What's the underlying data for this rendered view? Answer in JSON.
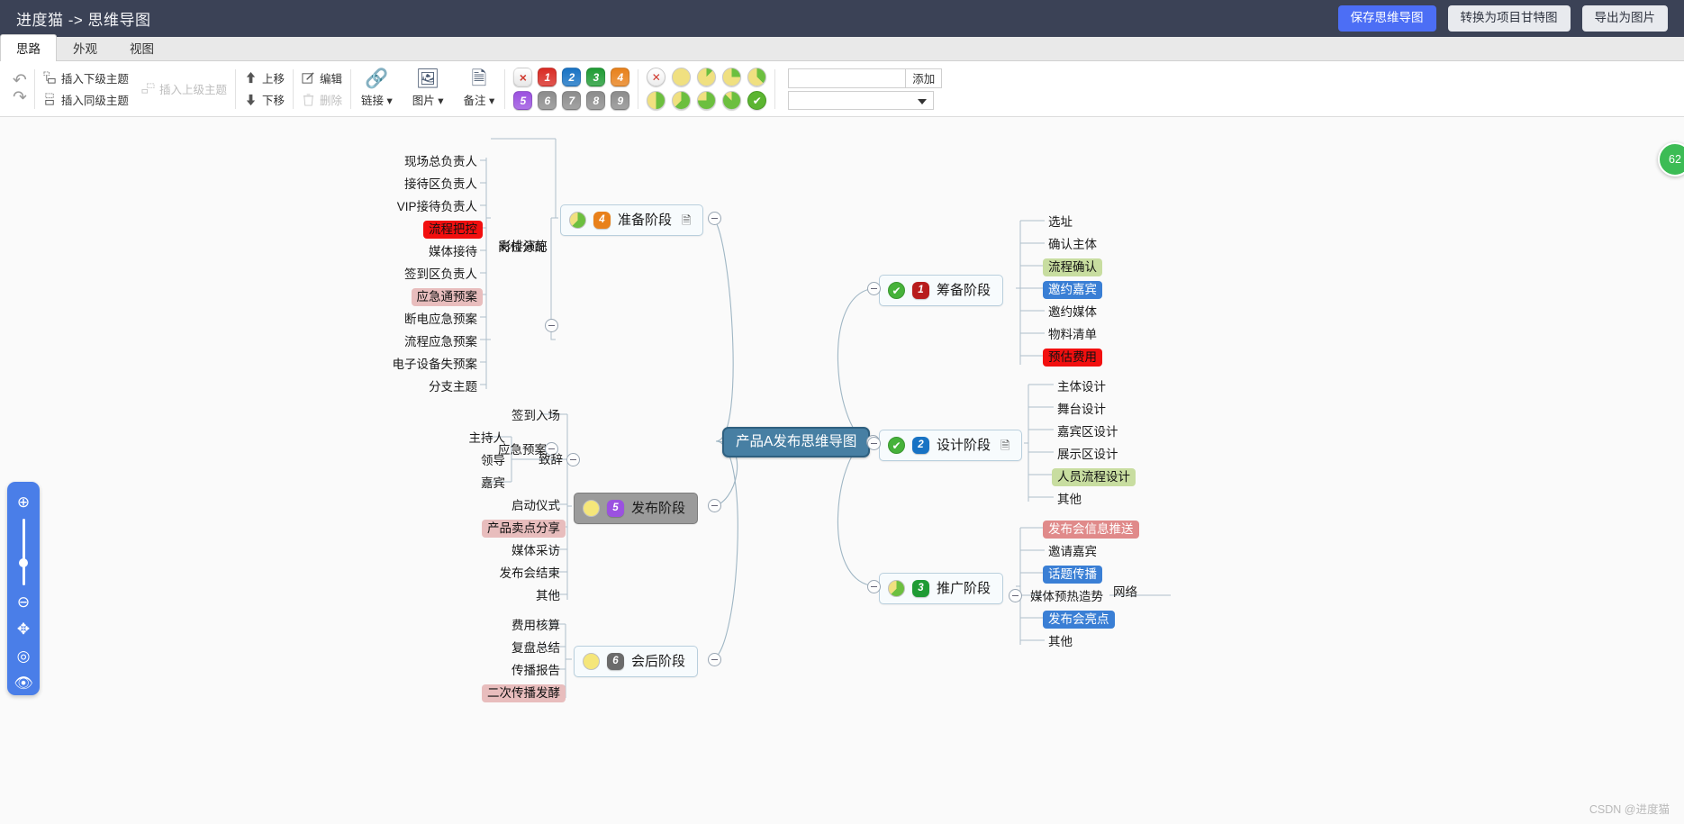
{
  "titlebar": {
    "app_title": "进度猫 -> 思维导图",
    "buttons": [
      {
        "label": "保存思维导图",
        "style": "primary"
      },
      {
        "label": "转换为项目甘特图",
        "style": "light"
      },
      {
        "label": "导出为图片",
        "style": "light"
      }
    ]
  },
  "tabs": [
    {
      "label": "思路",
      "active": true
    },
    {
      "label": "外观",
      "active": false
    },
    {
      "label": "视图",
      "active": false
    }
  ],
  "toolbar": {
    "undo_icon": "undo-icon",
    "redo_icon": "redo-icon",
    "insert_child": "插入下级主题",
    "insert_parent": "插入上级主题",
    "insert_sibling": "插入同级主题",
    "move_up": "上移",
    "move_down": "下移",
    "edit": "编辑",
    "delete": "删除",
    "link": "链接",
    "image": "图片",
    "note": "备注",
    "priority_chips": [
      "×",
      "1",
      "2",
      "3",
      "4",
      "5",
      "6",
      "7",
      "8",
      "9"
    ],
    "priority_colors": [
      "#ffffff",
      "#d92b24",
      "#1873c4",
      "#1f9b34",
      "#e8811b",
      "#9b51e0",
      "#8c8c8c",
      "#8c8c8c",
      "#8c8c8c",
      "#8c8c8c"
    ],
    "progress_labels": [
      "0%",
      "12%",
      "25%",
      "37%",
      "50%",
      "62%",
      "75%",
      "87%",
      "100%"
    ],
    "add_input_value": "",
    "add_button": "添加",
    "select_value": ""
  },
  "mindmap": {
    "root": "产品A发布思维导图",
    "phases": [
      {
        "name": "准备阶段",
        "priority": "4",
        "priority_color": "#e8811b",
        "progress": 62,
        "has_note": true,
        "selected": false
      },
      {
        "name": "筹备阶段",
        "priority": "1",
        "priority_color": "#b81d1d",
        "progress": 100,
        "has_note": false,
        "selected": false
      },
      {
        "name": "设计阶段",
        "priority": "2",
        "priority_color": "#1873c4",
        "progress": 100,
        "has_note": true,
        "selected": false
      },
      {
        "name": "发布阶段",
        "priority": "5",
        "priority_color": "#9b51e0",
        "progress": 0,
        "has_note": false,
        "selected": true
      },
      {
        "name": "推广阶段",
        "priority": "3",
        "priority_color": "#1f9b34",
        "progress": 62,
        "has_note": false,
        "selected": false
      },
      {
        "name": "会后阶段",
        "priority": "6",
        "priority_color": "#6b6b6b",
        "progress": 0,
        "has_note": false,
        "selected": false
      }
    ],
    "prep_rehearsal": "彩排演练",
    "prep_group_posts": "岗位分配",
    "prep_group_emergency": "应急预案",
    "posts_items": [
      {
        "label": "现场总负责人",
        "style": "plain"
      },
      {
        "label": "接待区负责人",
        "style": "plain"
      },
      {
        "label": "VIP接待负责人",
        "style": "plain"
      },
      {
        "label": "流程把控",
        "style": "red"
      },
      {
        "label": "媒体接待",
        "style": "plain"
      },
      {
        "label": "签到区负责人",
        "style": "plain"
      }
    ],
    "emergency_items": [
      {
        "label": "应急通预案",
        "style": "pink"
      },
      {
        "label": "断电应急预案",
        "style": "plain"
      },
      {
        "label": "流程应急预案",
        "style": "plain"
      },
      {
        "label": "电子设备失预案",
        "style": "plain"
      },
      {
        "label": "分支主题",
        "style": "plain"
      }
    ],
    "release_items": [
      {
        "label": "签到入场",
        "style": "plain"
      },
      {
        "label": "致辞",
        "style": "plain"
      },
      {
        "label": "启动仪式",
        "style": "plain"
      },
      {
        "label": "产品卖点分享",
        "style": "pink"
      },
      {
        "label": "媒体采访",
        "style": "plain"
      },
      {
        "label": "发布会结束",
        "style": "plain"
      },
      {
        "label": "其他",
        "style": "plain"
      }
    ],
    "speech_items": [
      {
        "label": "主持人",
        "style": "plain"
      },
      {
        "label": "领导",
        "style": "plain"
      },
      {
        "label": "嘉宾",
        "style": "plain"
      }
    ],
    "post_meeting_items": [
      {
        "label": "费用核算",
        "style": "plain"
      },
      {
        "label": "复盘总结",
        "style": "plain"
      },
      {
        "label": "传播报告",
        "style": "plain"
      },
      {
        "label": "二次传播发酵",
        "style": "pink"
      }
    ],
    "planning_items": [
      {
        "label": "选址",
        "style": "plain"
      },
      {
        "label": "确认主体",
        "style": "plain"
      },
      {
        "label": "流程确认",
        "style": "green"
      },
      {
        "label": "邀约嘉宾",
        "style": "blue"
      },
      {
        "label": "邀约媒体",
        "style": "plain"
      },
      {
        "label": "物料清单",
        "style": "plain"
      },
      {
        "label": "预估费用",
        "style": "red"
      }
    ],
    "design_items": [
      {
        "label": "主体设计",
        "style": "plain"
      },
      {
        "label": "舞台设计",
        "style": "plain"
      },
      {
        "label": "嘉宾区设计",
        "style": "plain"
      },
      {
        "label": "展示区设计",
        "style": "plain"
      },
      {
        "label": "人员流程设计",
        "style": "green"
      },
      {
        "label": "其他",
        "style": "plain"
      }
    ],
    "promo_items": [
      {
        "label": "发布会信息推送",
        "style": "rose"
      },
      {
        "label": "邀请嘉宾",
        "style": "plain"
      },
      {
        "label": "话题传播",
        "style": "blue"
      },
      {
        "label": "媒体预热造势",
        "style": "plain"
      },
      {
        "label": "发布会亮点",
        "style": "blue"
      },
      {
        "label": "其他",
        "style": "plain"
      }
    ],
    "promo_sub_network": "网络"
  },
  "navpanel": {
    "zoom_in_icon": "zoom-in-icon",
    "zoom_out_icon": "zoom-out-icon",
    "move_icon": "move-icon",
    "center_icon": "center-icon",
    "eye_icon": "eye-icon"
  },
  "progress_bubble": "62",
  "watermark": "CSDN @进度猫"
}
